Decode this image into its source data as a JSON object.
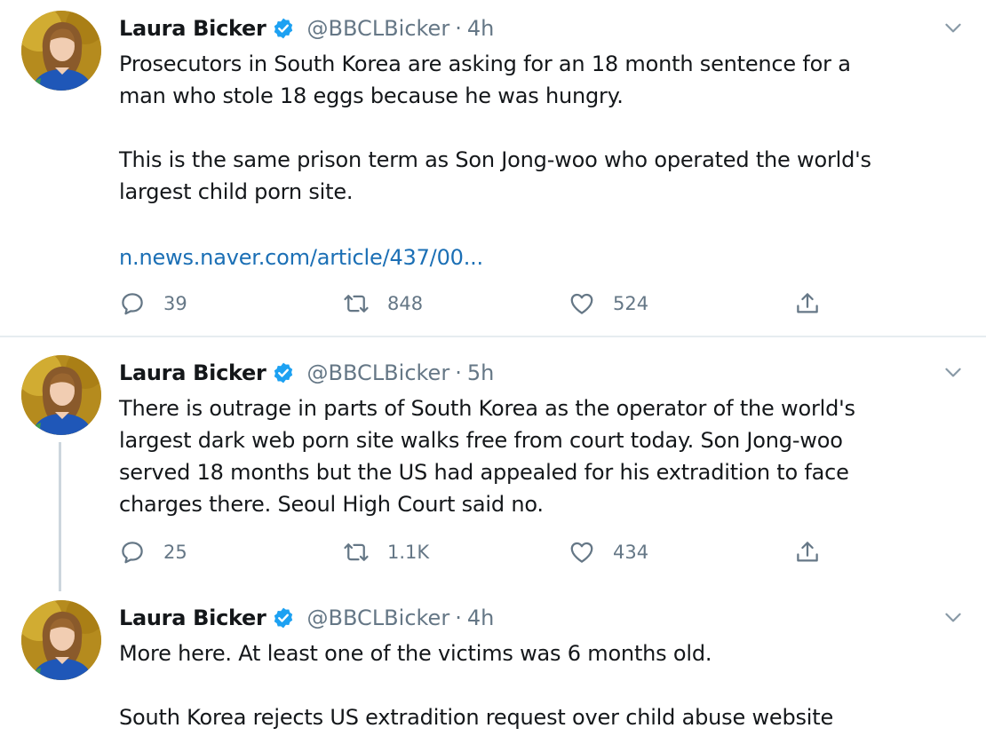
{
  "tweets": [
    {
      "name": "Laura Bicker",
      "handle": "@BBCLBicker",
      "separator": "·",
      "time": "4h",
      "paragraphs": [
        "Prosecutors in South Korea are asking for an 18 month sentence for a\nman who stole 18 eggs because he was hungry.",
        "This is the same prison term as Son Jong-woo who operated the world's\nlargest child porn site."
      ],
      "link": "n.news.naver.com/article/437/00...",
      "replies": "39",
      "retweets": "848",
      "likes": "524"
    },
    {
      "name": "Laura Bicker",
      "handle": "@BBCLBicker",
      "separator": "·",
      "time": "5h",
      "paragraphs": [
        "There is outrage in parts of South Korea as the operator of the world's\nlargest dark web porn site walks free from court today. Son Jong-woo\nserved 18 months but the US had appealed for his extradition to face\ncharges there. Seoul High Court said no."
      ],
      "replies": "25",
      "retweets": "1.1K",
      "likes": "434"
    },
    {
      "name": "Laura Bicker",
      "handle": "@BBCLBicker",
      "separator": "·",
      "time": "4h",
      "paragraphs": [
        "More here. At least one of the victims was 6 months old.",
        "South Korea rejects US extradition request over child abuse website"
      ]
    }
  ],
  "icons": {
    "reply": "reply-icon",
    "retweet": "retweet-icon",
    "like": "heart-icon",
    "share": "share-icon",
    "verified": "verified-badge-icon",
    "caret": "chevron-down-icon"
  },
  "colors": {
    "text": "#14171a",
    "muted": "#657786",
    "link": "#1b6fb5",
    "verified": "#1da1f2",
    "divider": "#e6ecf0"
  }
}
